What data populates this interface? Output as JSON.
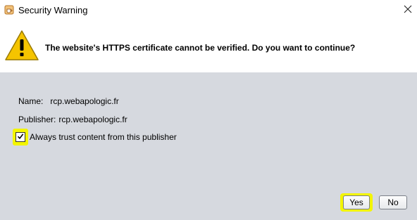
{
  "window": {
    "title": "Security Warning",
    "app_icon": "java-cup-icon",
    "close_icon": "close-icon"
  },
  "header": {
    "warning_icon": "warning-triangle-icon",
    "message": "The website's HTTPS certificate cannot be verified. Do you want to continue?"
  },
  "details": {
    "name_label": "Name:",
    "name_value": "rcp.webapologic.fr",
    "publisher_label": "Publisher:",
    "publisher_value": "rcp.webapologic.fr"
  },
  "trust": {
    "label": "Always trust content from this publisher",
    "checked": true
  },
  "buttons": {
    "yes": "Yes",
    "no": "No"
  },
  "colors": {
    "panel_background": "#d6d9df",
    "highlight": "#f3f500",
    "warning_fill": "#f5c400"
  }
}
